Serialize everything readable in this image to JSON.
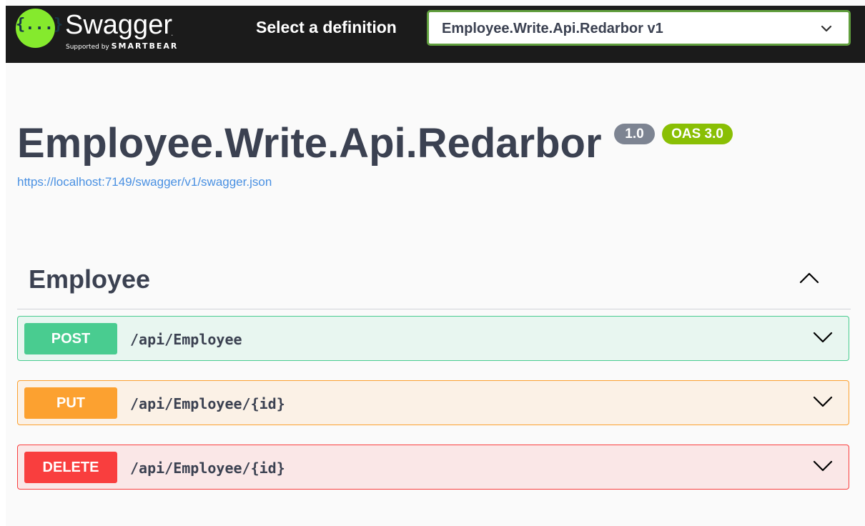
{
  "header": {
    "logo_text": "Swagger",
    "logo_dot": ".",
    "logo_braces": "{...}",
    "supported_by": "Supported by",
    "smartbear": "SMARTBEAR",
    "select_label": "Select a definition",
    "select_value": "Employee.Write.Api.Redarbor v1",
    "colors": {
      "bar": "#1b1b1b",
      "logo": "#85ea2d",
      "select_border": "#62a03f"
    }
  },
  "info": {
    "title": "Employee.Write.Api.Redarbor",
    "version_badge": "1.0",
    "oas_badge": "OAS 3.0",
    "spec_url": "https://localhost:7149/swagger/v1/swagger.json"
  },
  "tag": {
    "name": "Employee",
    "expanded": true,
    "toggle_icon": "chevron-up-icon"
  },
  "operations": [
    {
      "method": "POST",
      "path": "/api/Employee",
      "color": "#49cc90",
      "expand_icon": "chevron-down-icon"
    },
    {
      "method": "PUT",
      "path": "/api/Employee/{id}",
      "color": "#fca130",
      "expand_icon": "chevron-down-icon"
    },
    {
      "method": "DELETE",
      "path": "/api/Employee/{id}",
      "color": "#f93e3e",
      "expand_icon": "chevron-down-icon"
    }
  ]
}
